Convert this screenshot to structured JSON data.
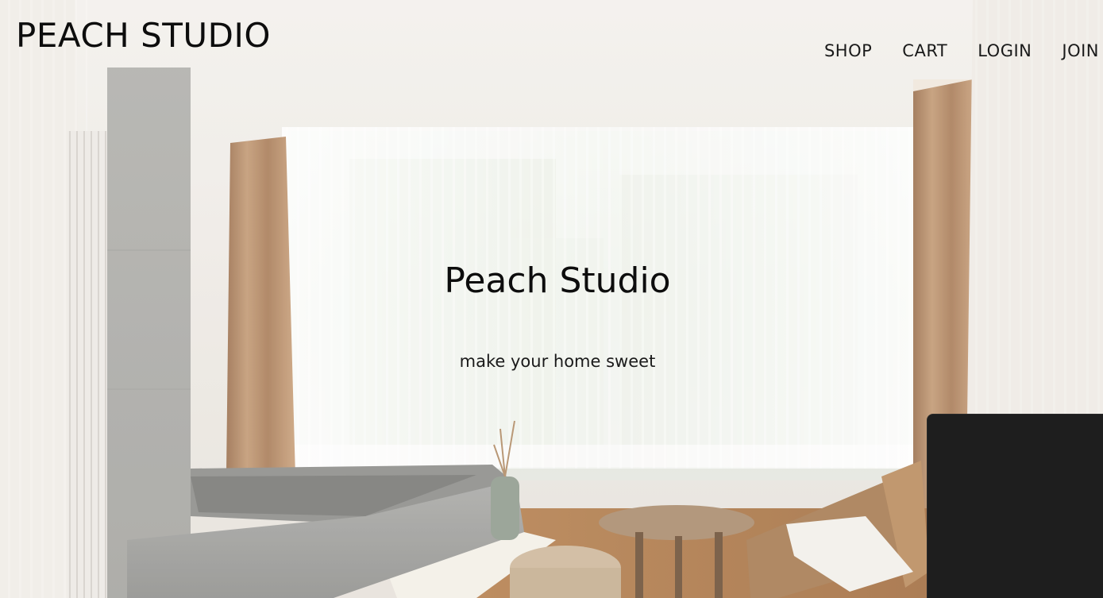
{
  "header": {
    "brand": "PEACH STUDIO",
    "nav": [
      {
        "label": "SHOP"
      },
      {
        "label": "CART"
      },
      {
        "label": "LOGIN"
      },
      {
        "label": "JOIN"
      }
    ]
  },
  "hero": {
    "title": "Peach Studio",
    "subtitle": "make your home sweet",
    "background_icon": "interior-room-photo"
  },
  "colors": {
    "text": "#0d0d0d",
    "panel": "#1e1e1e"
  }
}
